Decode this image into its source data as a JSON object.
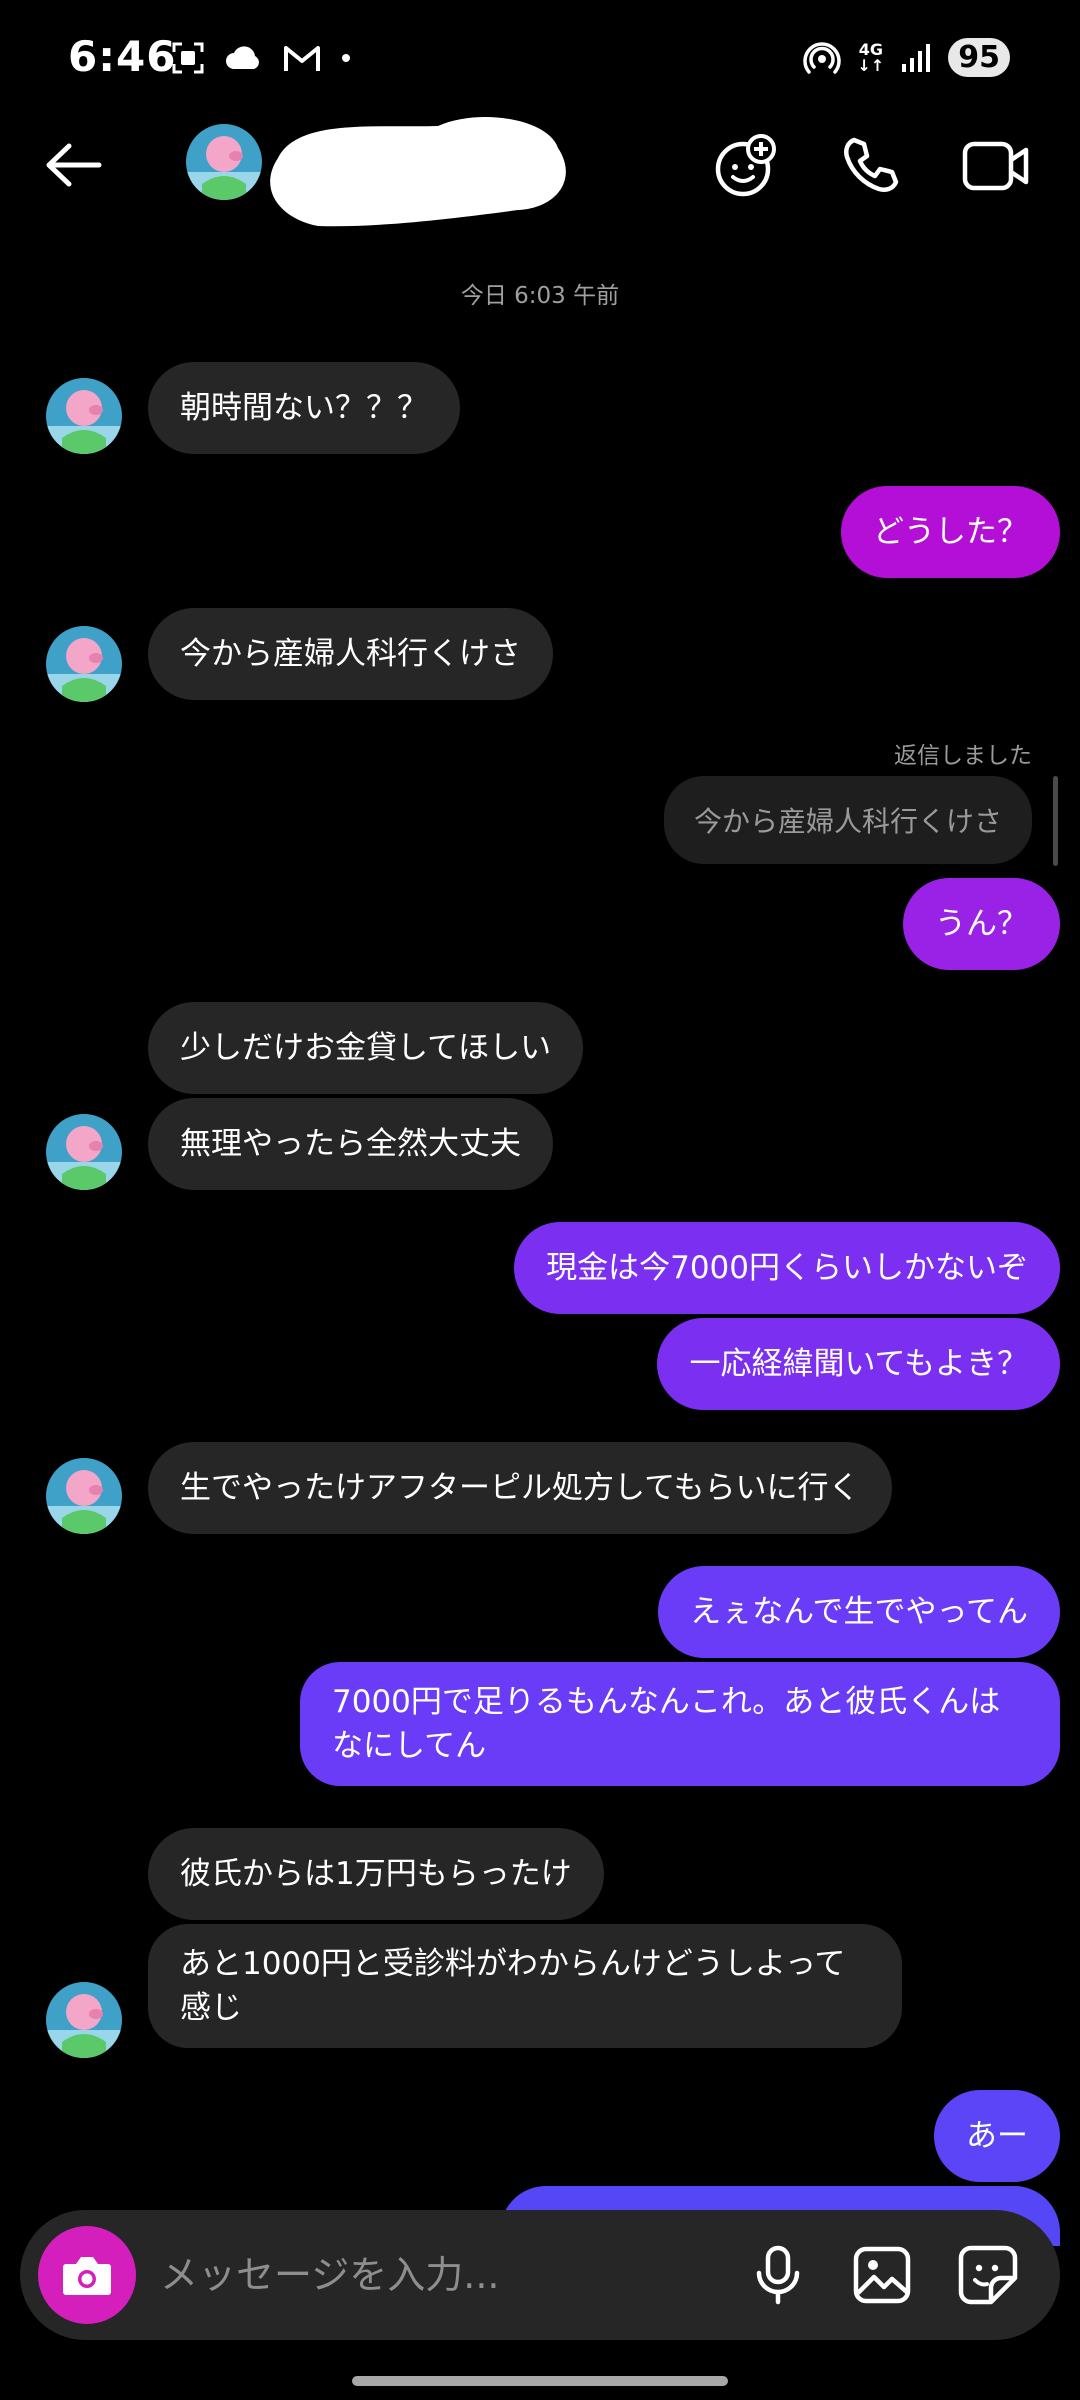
{
  "status_bar": {
    "time": "6:46",
    "network": "4G",
    "battery": "95"
  },
  "header": {
    "back_icon": "arrow-left-icon",
    "contact_avatar": "pig-avatar",
    "buttons": [
      "add-effect-icon",
      "phone-icon",
      "video-camera-icon"
    ]
  },
  "chat": {
    "timestamp": "今日 6:03 午前",
    "reply_label": "返信しました",
    "reply_quote": "今から産婦人科行くけさ",
    "messages": [
      {
        "side": "in",
        "text": "朝時間ない？？？"
      },
      {
        "side": "out",
        "text": "どうした？",
        "color": "#b40fd6"
      },
      {
        "side": "in",
        "text": "今から産婦人科行くけさ"
      },
      {
        "side": "out",
        "text": "うん？",
        "color": "#9a22e6"
      },
      {
        "side": "in",
        "text": "少しだけお金貸してほしい"
      },
      {
        "side": "in",
        "text": "無理やったら全然大丈夫"
      },
      {
        "side": "out",
        "text": "現金は今7000円くらいしかないぞ",
        "color": "#7b2ff0"
      },
      {
        "side": "out",
        "text": "一応経緯聞いてもよき？",
        "color": "#7b2ff0"
      },
      {
        "side": "in",
        "text": "生でやったけアフターピル処方してもらいに行く"
      },
      {
        "side": "out",
        "text": "えぇなんで生でやってん",
        "color": "#6a3cf7"
      },
      {
        "side": "out",
        "text": "7000円で足りるもんなんこれ。あと彼氏くんはなにしてん",
        "color": "#6a3cf7"
      },
      {
        "side": "in",
        "text": "彼氏からは1万円もらったけ"
      },
      {
        "side": "in",
        "text": "あと1000円と受診料がわからんけどうしよって感じ"
      },
      {
        "side": "out",
        "text": "あー",
        "color": "#5b45f6"
      }
    ]
  },
  "composer": {
    "placeholder": "メッセージを入力...",
    "icons": [
      "camera-icon",
      "microphone-icon",
      "image-icon",
      "sticker-icon"
    ],
    "accent": "#d41fbd"
  }
}
